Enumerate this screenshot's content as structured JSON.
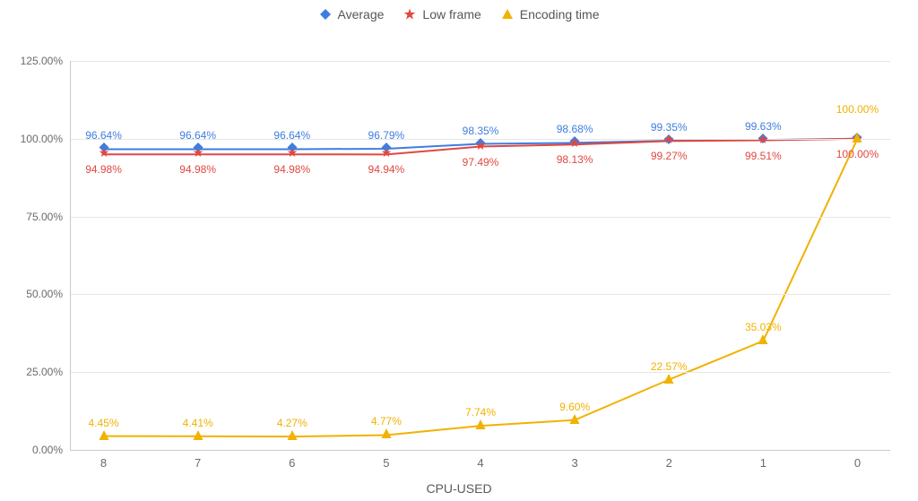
{
  "chart_data": {
    "type": "line",
    "categories": [
      "8",
      "7",
      "6",
      "5",
      "4",
      "3",
      "2",
      "1",
      "0"
    ],
    "series": [
      {
        "name": "Average",
        "color": "#3f7de0",
        "marker": "diamond",
        "values": [
          96.64,
          96.64,
          96.64,
          96.79,
          98.35,
          98.68,
          99.35,
          99.63,
          100.0
        ]
      },
      {
        "name": "Low frame",
        "color": "#e04840",
        "marker": "star",
        "values": [
          94.98,
          94.98,
          94.98,
          94.94,
          97.49,
          98.13,
          99.27,
          99.51,
          100.0
        ]
      },
      {
        "name": "Encoding time",
        "color": "#f1b200",
        "marker": "triangle",
        "values": [
          4.45,
          4.41,
          4.27,
          4.77,
          7.74,
          9.6,
          22.57,
          35.03,
          100.0
        ]
      }
    ],
    "title": "",
    "xlabel": "CPU-USED",
    "ylabel": "",
    "ylim": [
      0,
      125
    ],
    "yticks": [
      0,
      25,
      50,
      75,
      100,
      125
    ],
    "value_suffix": "%",
    "value_decimals": 2
  }
}
